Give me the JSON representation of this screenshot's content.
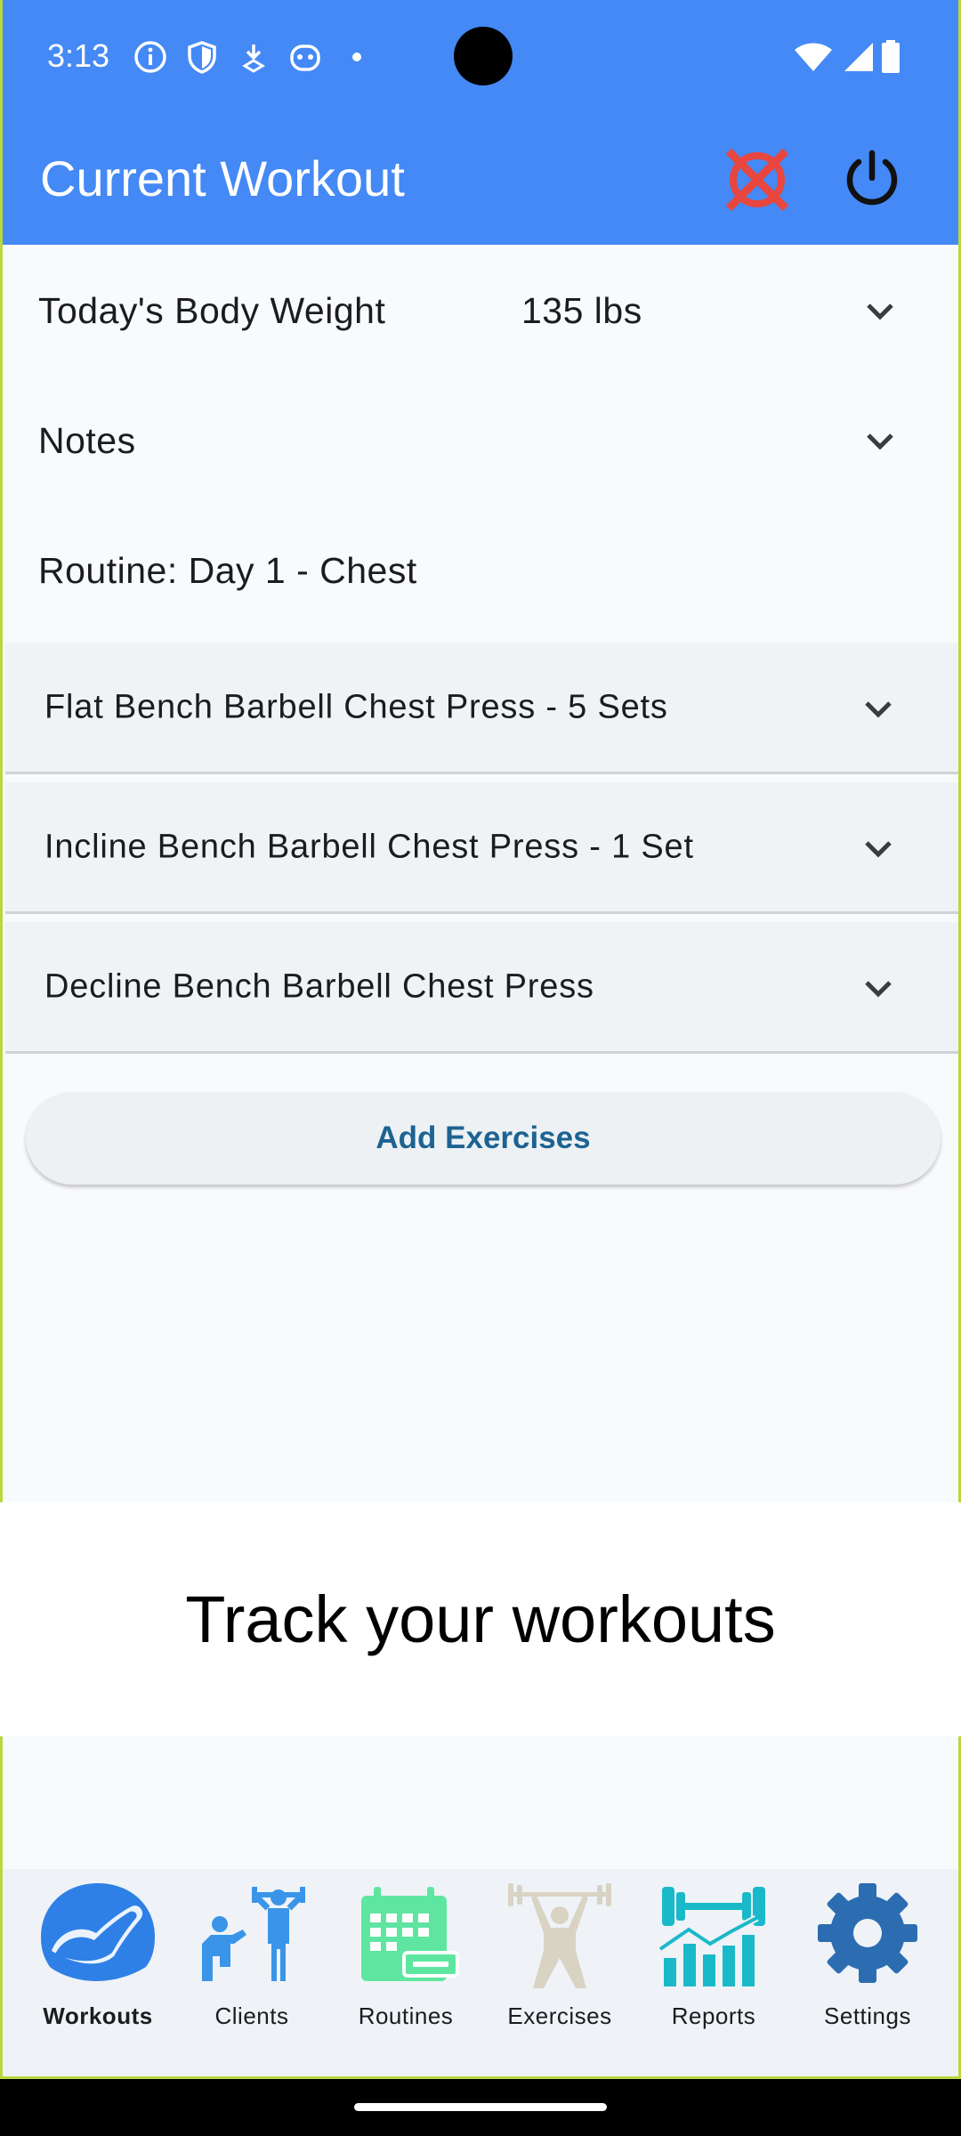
{
  "status_bar": {
    "time": "3:13"
  },
  "app_bar": {
    "title": "Current Workout",
    "colors": {
      "bar": "#4489f5",
      "cancel": "#e8463e"
    }
  },
  "body_weight": {
    "label": "Today's Body Weight",
    "value": "135 lbs"
  },
  "notes": {
    "label": "Notes"
  },
  "routine": {
    "label": "Routine: Day 1 - Chest"
  },
  "exercises": [
    {
      "label": "Flat Bench Barbell Chest Press - 5 Sets"
    },
    {
      "label": "Incline Bench Barbell Chest Press - 1 Set"
    },
    {
      "label": "Decline Bench Barbell Chest Press"
    }
  ],
  "add_button": {
    "label": "Add Exercises"
  },
  "banner": {
    "text": "Track your workouts"
  },
  "nav": [
    {
      "label": "Workouts",
      "icon": "flexed-arm-icon",
      "active": true
    },
    {
      "label": "Clients",
      "icon": "trainer-client-icon"
    },
    {
      "label": "Routines",
      "icon": "calendar-dumbbell-icon"
    },
    {
      "label": "Exercises",
      "icon": "weightlifter-icon"
    },
    {
      "label": "Reports",
      "icon": "barbell-chart-icon"
    },
    {
      "label": "Settings",
      "icon": "gear-icon"
    }
  ]
}
